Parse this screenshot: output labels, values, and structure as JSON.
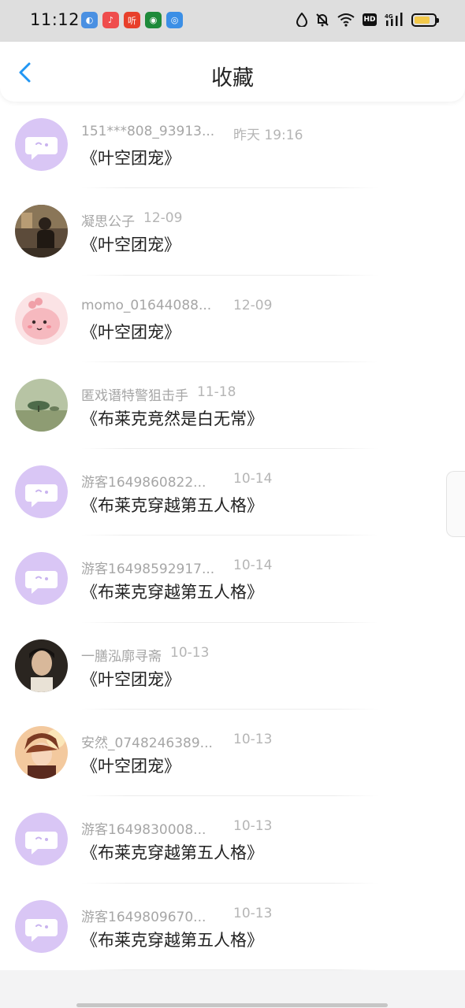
{
  "status_bar": {
    "time": "11:12",
    "apps": [
      {
        "icon": "browser-app-icon",
        "color": "#4a90e2",
        "glyph": "◐"
      },
      {
        "icon": "music-app-icon",
        "color": "#ef4d4d",
        "glyph": "♪"
      },
      {
        "icon": "listen-app-icon",
        "color": "#e8402b",
        "glyph": "听"
      },
      {
        "icon": "green-app-icon",
        "color": "#1e8a3a",
        "glyph": "◉"
      },
      {
        "icon": "blue-app-icon",
        "color": "#3b8fe6",
        "glyph": "◎"
      }
    ],
    "hd": "HD",
    "network": "4G",
    "battery_level": 0.8,
    "battery_color": "#f3c94a"
  },
  "header": {
    "title": "收藏",
    "accent": "#2196f3"
  },
  "favorites": [
    {
      "user": "151***808_93913...",
      "date": "昨天 19:16",
      "title": "《叶空团宠》",
      "avatar": "chat-bubble"
    },
    {
      "user": "凝思公子",
      "date": "12-09",
      "title": "《叶空团宠》",
      "avatar": "photo-person-dark"
    },
    {
      "user": "momo_01644088...",
      "date": "12-09",
      "title": "《叶空团宠》",
      "avatar": "pink-cartoon"
    },
    {
      "user": "匿戏谮特警狙击手",
      "date": "11-18",
      "title": "《布莱克竞然是白无常》",
      "avatar": "landscape-tree"
    },
    {
      "user": "游客1649860822...",
      "date": "10-14",
      "title": "《布莱克穿越第五人格》",
      "avatar": "chat-bubble"
    },
    {
      "user": "游客16498592917...",
      "date": "10-14",
      "title": "《布莱克穿越第五人格》",
      "avatar": "chat-bubble"
    },
    {
      "user": "一膳泓廓寻斋",
      "date": "10-13",
      "title": "《叶空团宠》",
      "avatar": "photo-person-light"
    },
    {
      "user": "安然_0748246389...",
      "date": "10-13",
      "title": "《叶空团宠》",
      "avatar": "anime-boy"
    },
    {
      "user": "游客1649830008...",
      "date": "10-13",
      "title": "《布莱克穿越第五人格》",
      "avatar": "chat-bubble"
    },
    {
      "user": "游客1649809670...",
      "date": "10-13",
      "title": "《布莱克穿越第五人格》",
      "avatar": "chat-bubble"
    }
  ]
}
